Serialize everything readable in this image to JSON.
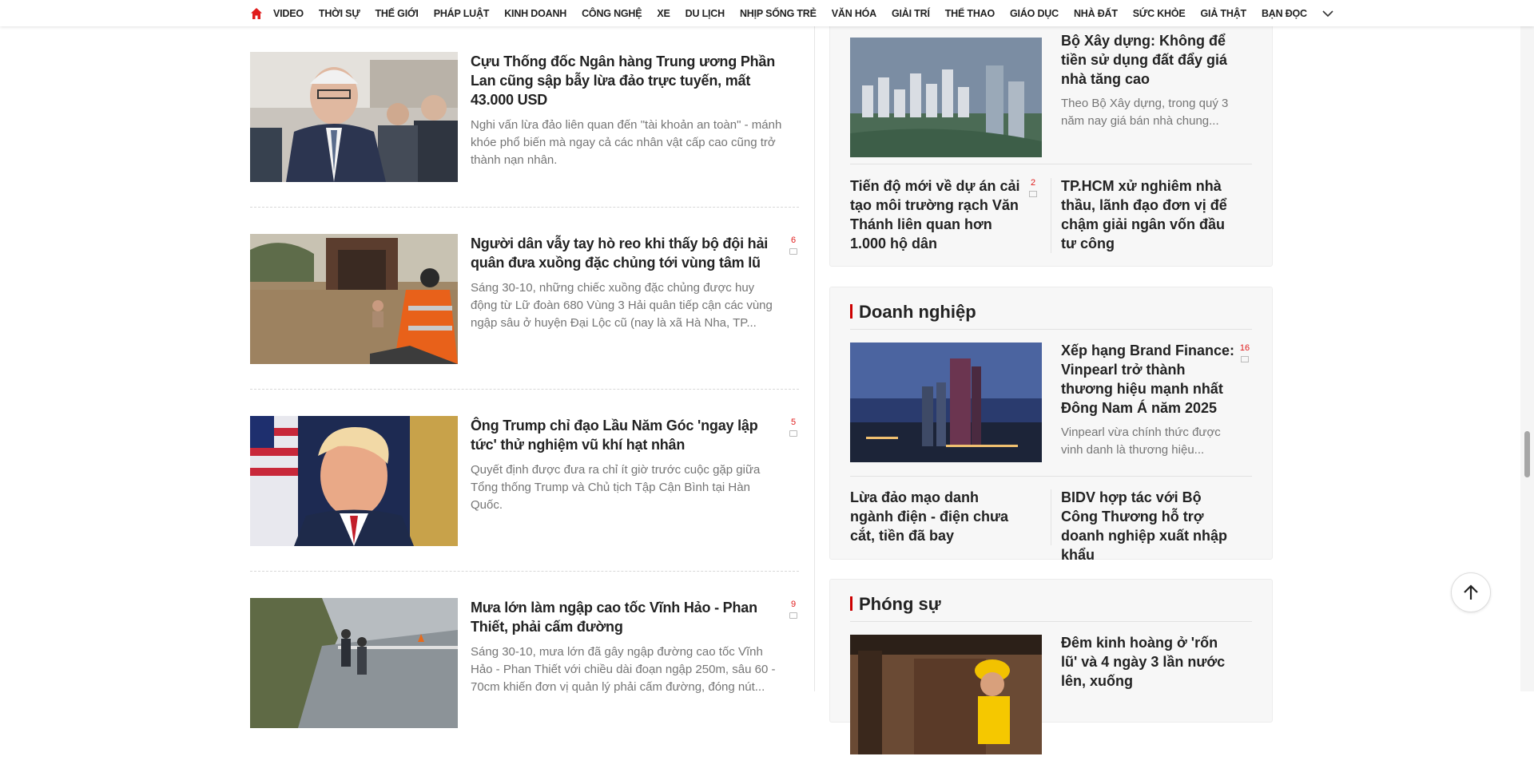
{
  "nav": {
    "home_icon": "home-icon",
    "items": [
      "VIDEO",
      "THỜI SỰ",
      "THẾ GIỚI",
      "PHÁP LUẬT",
      "KINH DOANH",
      "CÔNG NGHỆ",
      "XE",
      "DU LỊCH",
      "NHỊP SỐNG TRẺ",
      "VĂN HÓA",
      "GIẢI TRÍ",
      "THỂ THAO",
      "GIÁO DỤC",
      "NHÀ ĐẤT",
      "SỨC KHỎE",
      "GIẢ THẬT",
      "BẠN ĐỌC"
    ],
    "more_icon": "chevron-down-icon"
  },
  "articles": [
    {
      "title": "Cựu Thống đốc Ngân hàng Trung ương Phần Lan cũng sập bẫy lừa đảo trực tuyến, mất 43.000 USD",
      "desc": "Nghi vấn lừa đảo liên quan đến \"tài khoản an toàn\" - mánh khóe phổ biến mà ngay cả các nhân vật cấp cao cũng trở thành nạn nhân.",
      "comments": ""
    },
    {
      "title": "Người dân vẫy tay hò reo khi thấy bộ đội hải quân đưa xuồng đặc chủng tới vùng tâm lũ",
      "desc": "Sáng 30-10, những chiếc xuồng đặc chủng được huy động từ Lữ đoàn 680 Vùng 3 Hải quân tiếp cận các vùng ngập sâu ở huyện Đại Lộc cũ (nay là xã Hà Nha, TP...",
      "comments": "6"
    },
    {
      "title": "Ông Trump chỉ đạo Lầu Năm Góc 'ngay lập tức' thử nghiệm vũ khí hạt nhân",
      "desc": "Quyết định được đưa ra chỉ ít giờ trước cuộc gặp giữa Tổng thống Trump và Chủ tịch Tập Cận Bình tại Hàn Quốc.",
      "comments": "5"
    },
    {
      "title": "Mưa lớn làm ngập cao tốc Vĩnh Hảo - Phan Thiết, phải cấm đường",
      "desc": "Sáng 30-10, mưa lớn đã gây ngập đường cao tốc Vĩnh Hảo - Phan Thiết với chiều dài đoạn ngập 250m, sâu 60 - 70cm khiến đơn vị quản lý phải cấm đường, đóng nút...",
      "comments": "9"
    }
  ],
  "box_nhadat": {
    "lead_title": "Bộ Xây dựng: Không để tiền sử dụng đất đẩy giá nhà tăng cao",
    "lead_desc": "Theo Bộ Xây dựng, trong quý 3 năm nay giá bán nhà chung...",
    "sub_left": "Tiến độ mới về dự án cải tạo môi trường rạch Văn Thánh liên quan hơn 1.000 hộ dân",
    "sub_left_comments": "2",
    "sub_right": "TP.HCM xử nghiêm nhà thầu, lãnh đạo đơn vị để chậm giải ngân vốn đầu tư công"
  },
  "box_doanhnghiep": {
    "heading": "Doanh nghiệp",
    "lead_title": "Xếp hạng Brand Finance: Vinpearl trở thành thương hiệu mạnh nhất Đông Nam Á năm 2025",
    "lead_comments": "16",
    "lead_desc": "Vinpearl vừa chính thức được vinh danh là thương hiệu...",
    "sub_left": "Lừa đảo mạo danh ngành điện - điện chưa cắt, tiền đã bay",
    "sub_right": "BIDV hợp tác với Bộ Công Thương hỗ trợ doanh nghiệp xuất nhập khẩu"
  },
  "box_phongsu": {
    "heading": "Phóng sự",
    "lead_title": "Đêm kinh hoàng ở 'rốn lũ' và 4 ngày 3 lần nước lên, xuống"
  },
  "back_to_top_icon": "arrow-up-icon"
}
